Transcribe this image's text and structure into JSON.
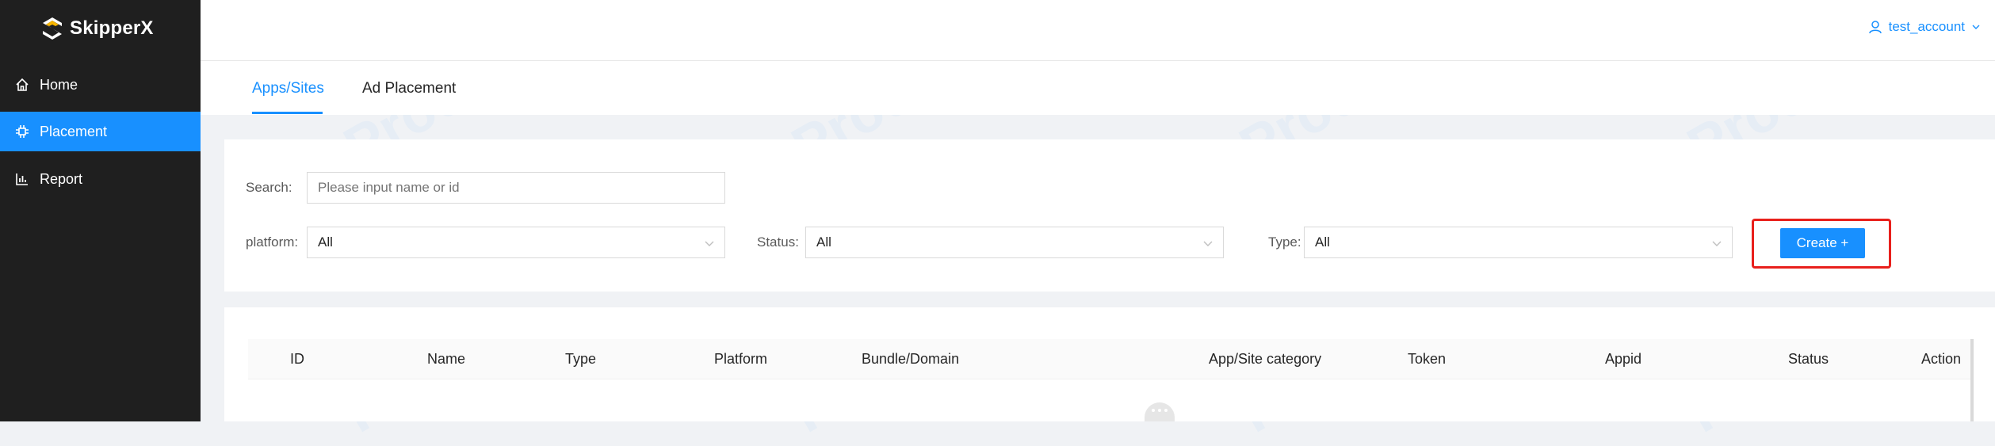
{
  "app": {
    "name": "SkipperX",
    "colors": {
      "sidebar": "#1f1f1f",
      "accent": "#1890ff",
      "highlight": "#e8201c"
    }
  },
  "sidebar": {
    "items": [
      {
        "label": "Home",
        "icon": "home-icon",
        "active": false
      },
      {
        "label": "Placement",
        "icon": "placement-icon",
        "active": true
      },
      {
        "label": "Report",
        "icon": "bar-chart-icon",
        "active": false
      }
    ]
  },
  "header": {
    "user": "test_account"
  },
  "tabs": [
    {
      "label": "Apps/Sites",
      "active": true
    },
    {
      "label": "Ad Placement",
      "active": false
    }
  ],
  "filters": {
    "search_label": "Search:",
    "search_placeholder": "Please input name or id",
    "platform_label": "platform:",
    "platform_value": "All",
    "status_label": "Status:",
    "status_value": "All",
    "type_label": "Type:",
    "type_value": "All",
    "create_label": "Create +"
  },
  "table": {
    "columns": [
      "ID",
      "Name",
      "Type",
      "Platform",
      "Bundle/Domain",
      "App/Site category",
      "Token",
      "Appid",
      "Status",
      "Action"
    ]
  },
  "watermark": "Prod"
}
